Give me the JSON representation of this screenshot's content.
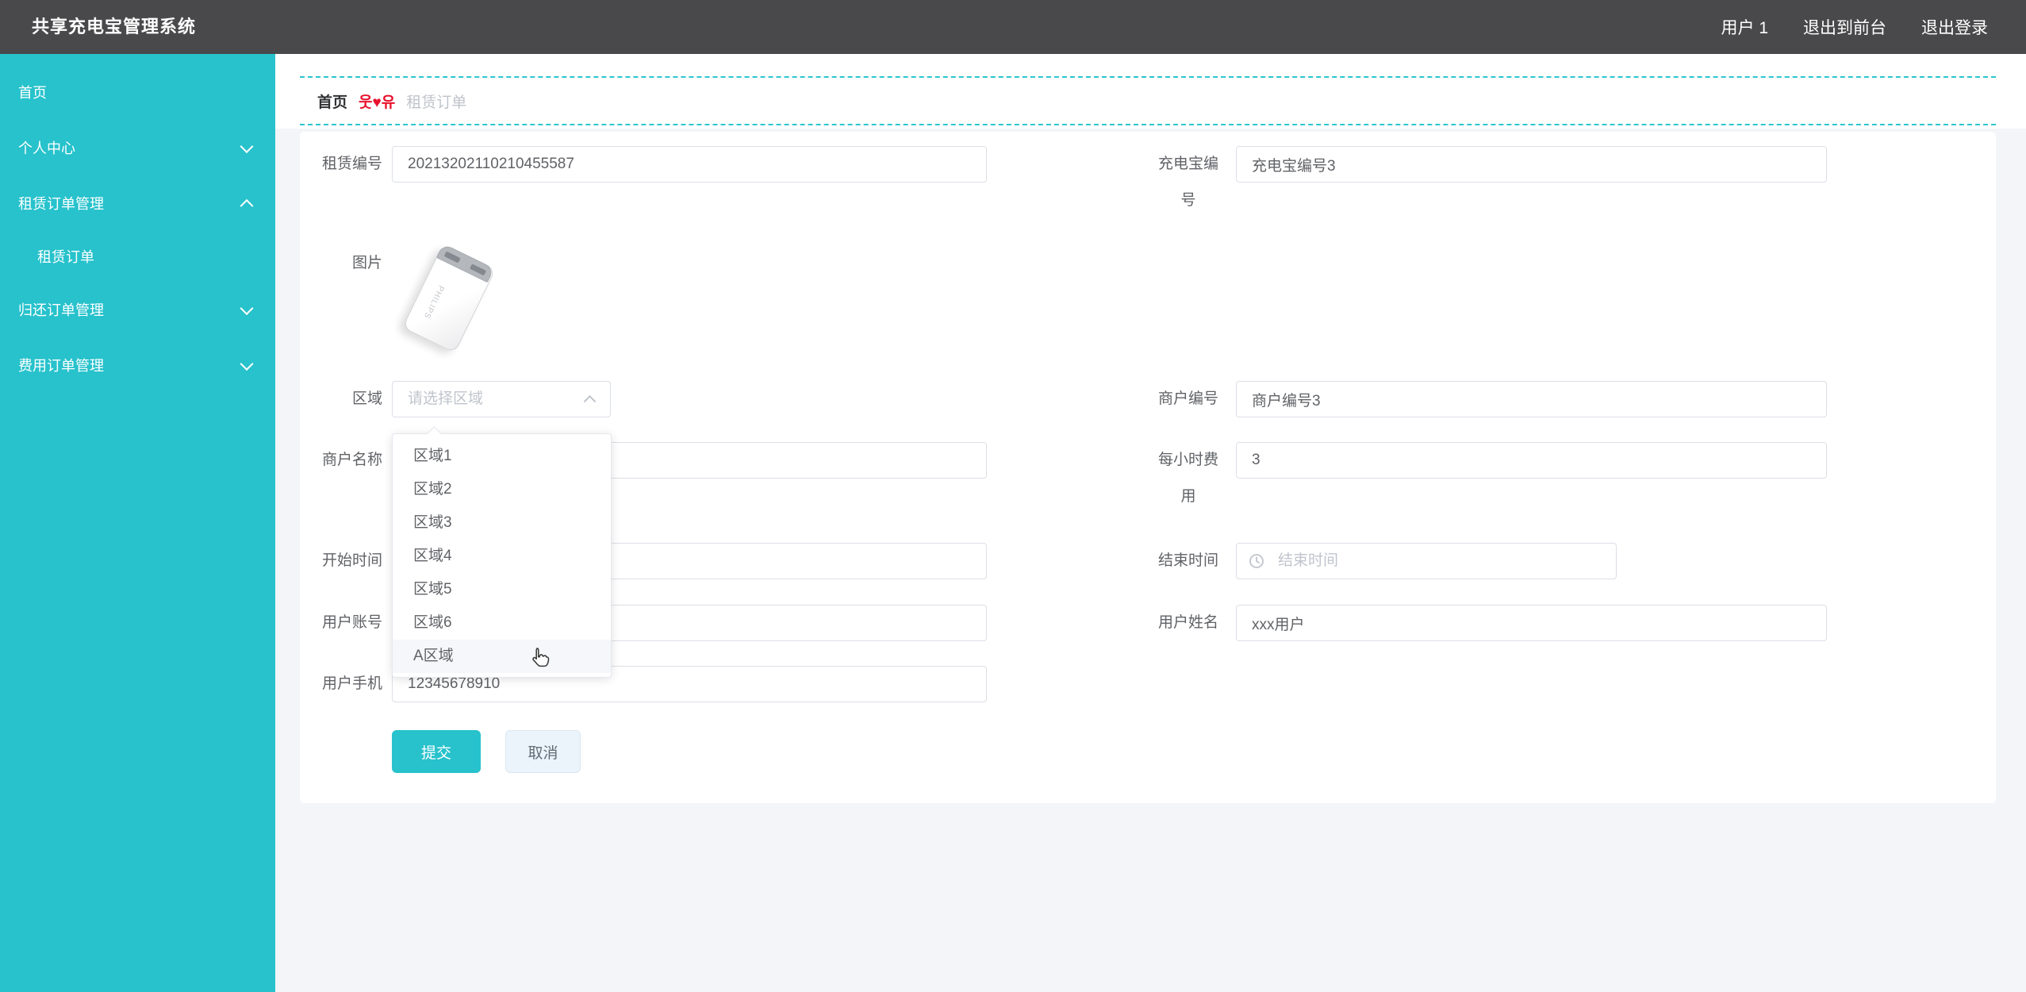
{
  "colors": {
    "accent": "#27c2cc",
    "topbar": "#49494b",
    "separator_red": "#e8112d",
    "card": "#ffffff",
    "page_bg": "#f3f5f8"
  },
  "topbar": {
    "title": "共享充电宝管理系统",
    "links": [
      "用户 1",
      "退出到前台",
      "退出登录"
    ]
  },
  "sidebar": {
    "items": [
      {
        "label": "首页",
        "arrow": "none",
        "sub": false
      },
      {
        "label": "个人中心",
        "arrow": "down",
        "sub": false
      },
      {
        "label": "租赁订单管理",
        "arrow": "up",
        "sub": false
      },
      {
        "label": "租赁订单",
        "arrow": "none",
        "sub": true
      },
      {
        "label": "归还订单管理",
        "arrow": "down",
        "sub": false
      },
      {
        "label": "费用订单管理",
        "arrow": "down",
        "sub": false
      }
    ]
  },
  "breadcrumb": {
    "home": "首页",
    "separator": "웃♥유",
    "current": "租赁订单"
  },
  "form": {
    "rental_no": {
      "label": "租赁编号",
      "value": "20213202110210455587"
    },
    "powerbank_no": {
      "label": "充电宝编号",
      "value": "充电宝编号3"
    },
    "image": {
      "label": "图片",
      "alt": "power-bank-photo"
    },
    "area": {
      "label": "区域",
      "placeholder": "请选择区域"
    },
    "merchant_no": {
      "label": "商户编号",
      "value": "商户编号3"
    },
    "merchant_name": {
      "label": "商户名称",
      "value": ""
    },
    "hourly_fee": {
      "label": "每小时费用",
      "value": "3"
    },
    "start_time": {
      "label": "开始时间",
      "value": ""
    },
    "end_time": {
      "label": "结束时间",
      "placeholder": "结束时间"
    },
    "user_account": {
      "label": "用户账号",
      "value": ""
    },
    "user_name": {
      "label": "用户姓名",
      "value": "xxx用户"
    },
    "user_phone": {
      "label": "用户手机",
      "value": "12345678910"
    }
  },
  "area_dropdown": {
    "options": [
      "区域1",
      "区域2",
      "区域3",
      "区域4",
      "区域5",
      "区域6",
      "A区域"
    ],
    "hovered": "A区域"
  },
  "actions": {
    "submit": "提交",
    "cancel": "取消"
  },
  "icons": [
    "chevron-down-icon",
    "chevron-up-icon",
    "clock-icon",
    "hand-cursor-icon"
  ]
}
